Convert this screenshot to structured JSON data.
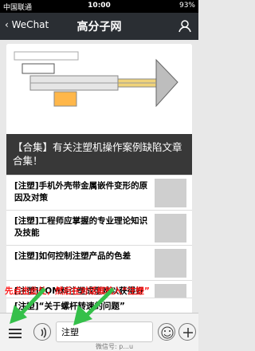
{
  "status_bar": {
    "carrier": "中国联通",
    "time": "10:00",
    "battery": "93%"
  },
  "nav": {
    "back_label": "WeChat",
    "title": "高分子网"
  },
  "feed": {
    "hero_caption": "【合集】有关注塑机操作案例缺陷文章合集！",
    "articles": [
      {
        "title": "[注塑]手机外壳带金属嵌件变形的原因及对策"
      },
      {
        "title": "[注塑]工程师应掌握的专业理论知识及技能"
      },
      {
        "title": "[注塑]如何控制注塑产品的色差"
      },
      {
        "title": "[注塑]POM料注塑成型难以获得好外观的原因"
      },
      {
        "title": "[注塑]“关于螺杆转速的问题”"
      }
    ]
  },
  "hint": "先点击此处，然后在对话框输入“注塑”",
  "input_bar": {
    "value": "注塑",
    "watermark": "微信号: p...u"
  },
  "colors": {
    "nav_bg": "#2a2e33",
    "hint": "#ff1a1a",
    "arrow": "#35c04a"
  }
}
